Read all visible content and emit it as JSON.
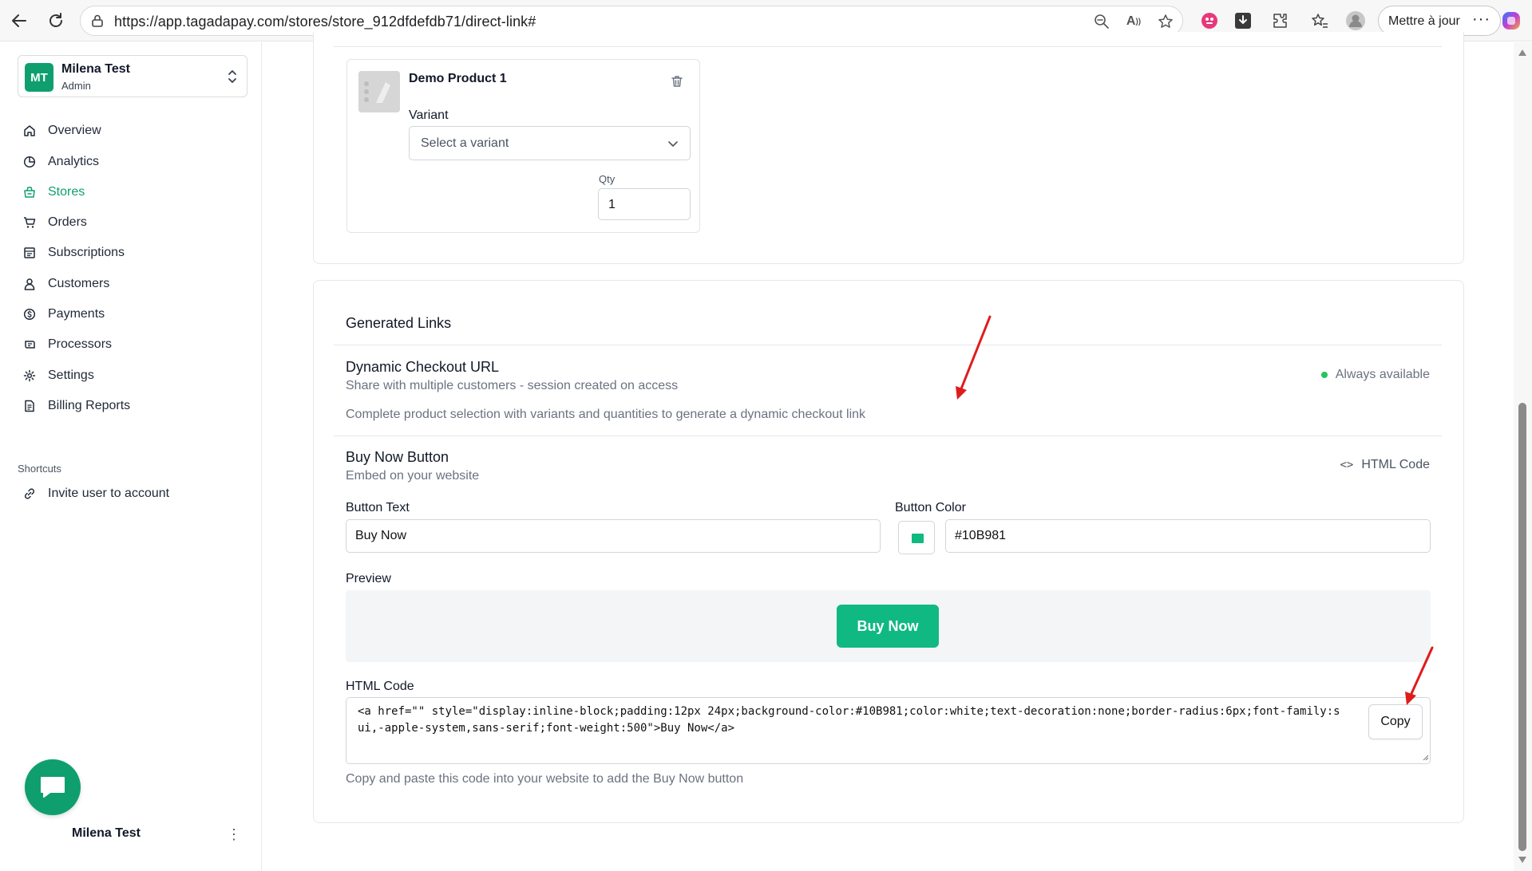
{
  "browser": {
    "url": "https://app.tagadapay.com/stores/store_912dfdefdb71/direct-link#",
    "update_label": "Mettre à jour",
    "more_label": "···"
  },
  "sidebar": {
    "account": {
      "initials": "MT",
      "name": "Milena Test",
      "role": "Admin"
    },
    "items": [
      {
        "label": "Overview",
        "icon": "home-icon"
      },
      {
        "label": "Analytics",
        "icon": "chart-pie-icon"
      },
      {
        "label": "Stores",
        "icon": "store-icon",
        "active": true
      },
      {
        "label": "Orders",
        "icon": "cart-icon"
      },
      {
        "label": "Subscriptions",
        "icon": "receipt-icon"
      },
      {
        "label": "Customers",
        "icon": "user-icon"
      },
      {
        "label": "Payments",
        "icon": "dollar-icon"
      },
      {
        "label": "Processors",
        "icon": "processor-icon"
      },
      {
        "label": "Settings",
        "icon": "gear-icon"
      },
      {
        "label": "Billing Reports",
        "icon": "report-icon"
      }
    ],
    "shortcuts_label": "Shortcuts",
    "shortcut_item": "Invite user to account",
    "footer_user": "Milena Test",
    "footer_more": "⋮"
  },
  "product": {
    "title": "Demo Product 1",
    "variant_label": "Variant",
    "variant_placeholder": "Select a variant",
    "qty_label": "Qty",
    "qty_value": "1"
  },
  "links": {
    "section_title": "Generated Links",
    "dynamic": {
      "title": "Dynamic Checkout URL",
      "subtitle": "Share with multiple customers - session created on access",
      "status": "Always available",
      "note": "Complete product selection with variants and quantities to generate a dynamic checkout link"
    },
    "buy_now": {
      "title": "Buy Now Button",
      "subtitle": "Embed on your website",
      "html_code_link": "HTML Code",
      "button_text_label": "Button Text",
      "button_text_value": "Buy Now",
      "button_color_label": "Button Color",
      "button_color_value": "#10B981",
      "preview_label": "Preview",
      "preview_button": "Buy Now",
      "html_code_label": "HTML Code",
      "code_line_1": "<a href=\"\" style=\"display:inline-block;padding:12px 24px;background-color:#10B981;color:white;text-decoration:none;border-radius:6px;font-family:s",
      "code_line_2": "ui,-apple-system,sans-serif;font-weight:500\">Buy Now</a>",
      "copy_label": "Copy",
      "hint": "Copy and paste this code into your website to add the Buy Now button"
    }
  },
  "colors": {
    "brand_green": "#0f9f6e",
    "button_green": "#10B981",
    "status_dot": "#22c55e",
    "annotation_arrow": "#e01b1b"
  }
}
